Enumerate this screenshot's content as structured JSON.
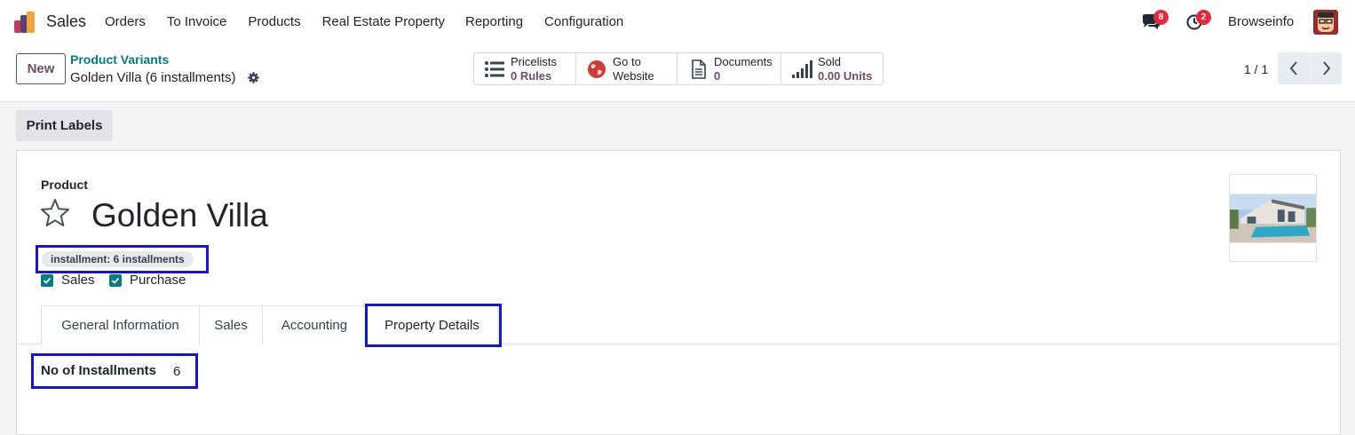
{
  "navbar": {
    "app_name": "Sales",
    "menu": [
      "Orders",
      "To Invoice",
      "Products",
      "Real Estate Property",
      "Reporting",
      "Configuration"
    ],
    "messages_count": "8",
    "activities_count": "2",
    "user_name": "Browseinfo"
  },
  "control_panel": {
    "new_label": "New",
    "breadcrumb_parent": "Product Variants",
    "breadcrumb_current": "Golden Villa (6 installments)",
    "stat_buttons": [
      {
        "icon": "list-icon",
        "line1": "Pricelists",
        "line2": "0 Rules"
      },
      {
        "icon": "globe-icon",
        "line1": "Go to",
        "line2": "Website"
      },
      {
        "icon": "document-icon",
        "line1": "Documents",
        "line2": "0"
      },
      {
        "icon": "bar-chart-icon",
        "line1": "Sold",
        "line2": "0.00 Units"
      }
    ],
    "pager": "1 / 1"
  },
  "actions": {
    "print_labels": "Print Labels"
  },
  "form": {
    "product_label": "Product",
    "product_name": "Golden Villa",
    "variant_tag": "installment: 6 installments",
    "checkboxes": [
      {
        "label": "Sales",
        "checked": true
      },
      {
        "label": "Purchase",
        "checked": true
      }
    ],
    "tabs": [
      "General Information",
      "Sales",
      "Accounting",
      "Property Details"
    ],
    "active_tab": "Property Details",
    "fields": {
      "installments_label": "No of Installments",
      "installments_value": "6"
    }
  },
  "colors": {
    "brand": "#714b67",
    "link": "#017e84",
    "badge": "#e4293f",
    "highlight": "#1414d9"
  }
}
